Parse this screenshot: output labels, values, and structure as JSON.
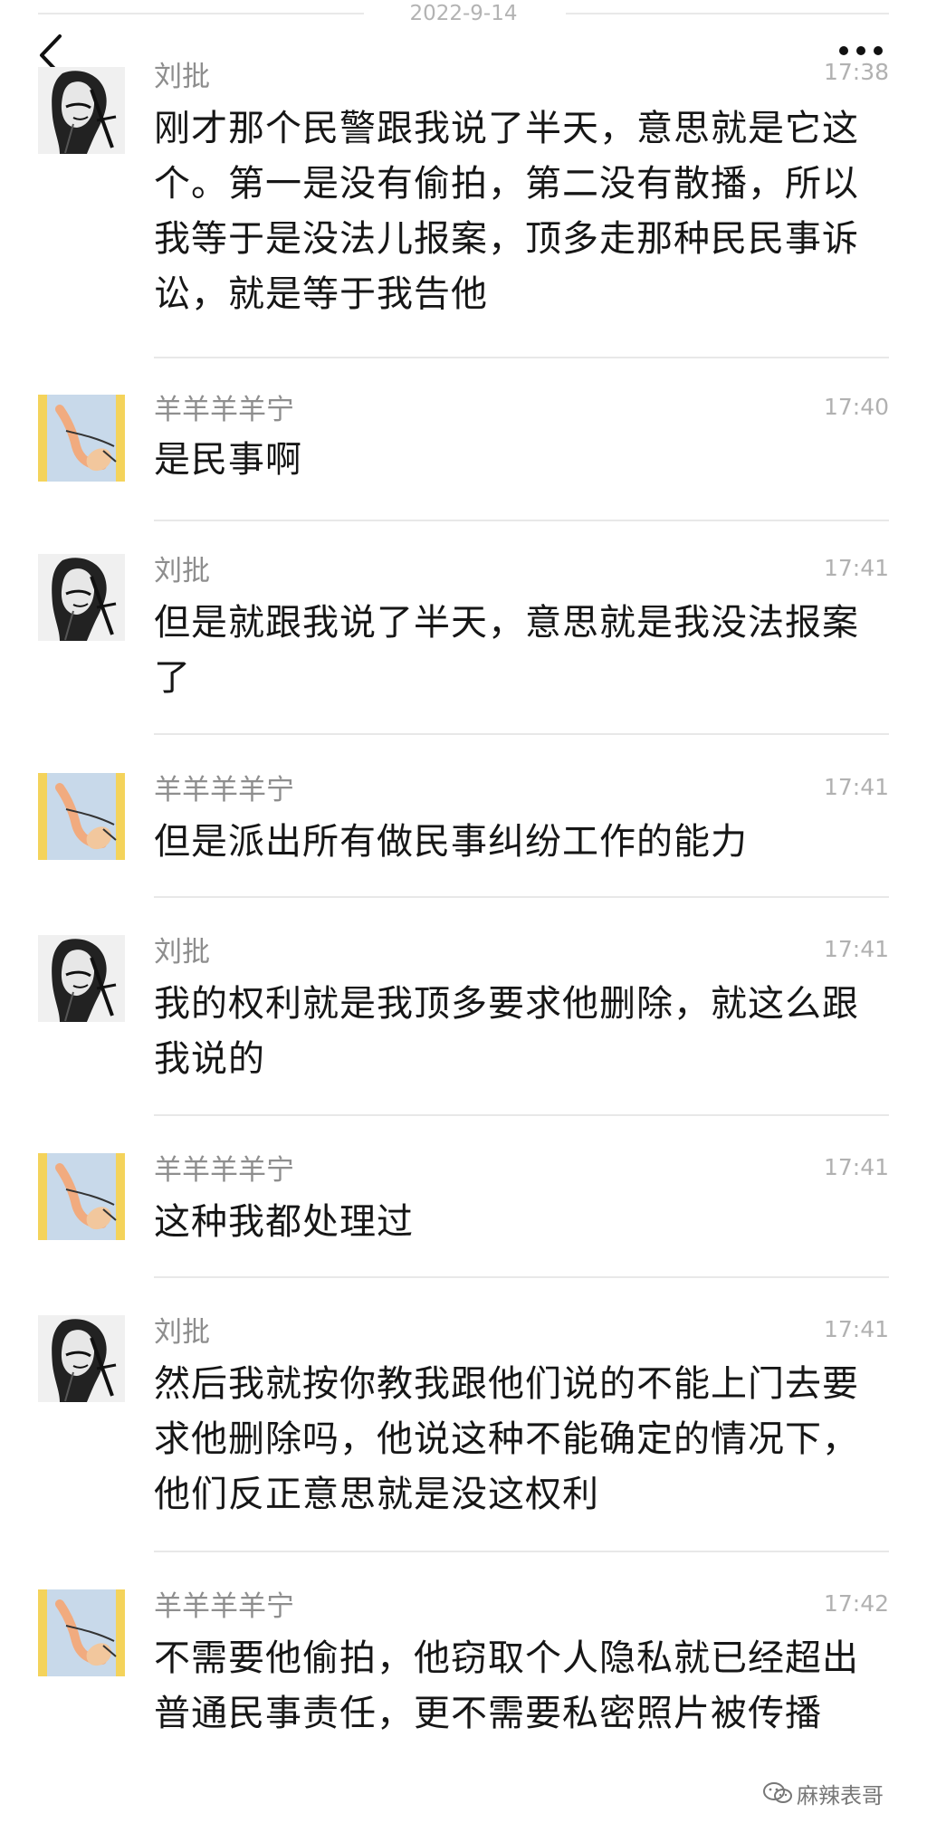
{
  "header": {
    "date": "2022-9-14",
    "back_icon": "chevron-left-icon",
    "more_icon": "more-horizontal-icon"
  },
  "messages": [
    {
      "sender": "刘批",
      "time": "17:38",
      "avatar": "liupi-avatar",
      "text": "刚才那个民警跟我说了半天，意思就是它这个。第一是没有偷拍，第二没有散播，所以我等于是没法儿报案，顶多走那种民民事诉讼，就是等于我告他"
    },
    {
      "sender": "羊羊羊羊宁",
      "time": "17:40",
      "avatar": "yangning-avatar",
      "text": "是民事啊"
    },
    {
      "sender": "刘批",
      "time": "17:41",
      "avatar": "liupi-avatar",
      "text": "但是就跟我说了半天，意思就是我没法报案了"
    },
    {
      "sender": "羊羊羊羊宁",
      "time": "17:41",
      "avatar": "yangning-avatar",
      "text": "但是派出所有做民事纠纷工作的能力"
    },
    {
      "sender": "刘批",
      "time": "17:41",
      "avatar": "liupi-avatar",
      "text": "我的权利就是我顶多要求他删除，就这么跟我说的"
    },
    {
      "sender": "羊羊羊羊宁",
      "time": "17:41",
      "avatar": "yangning-avatar",
      "text": "这种我都处理过"
    },
    {
      "sender": "刘批",
      "time": "17:41",
      "avatar": "liupi-avatar",
      "text": "然后我就按你教我跟他们说的不能上门去要求他删除吗，他说这种不能确定的情况下，他们反正意思就是没这权利"
    },
    {
      "sender": "羊羊羊羊宁",
      "time": "17:42",
      "avatar": "yangning-avatar",
      "text": "不需要他偷拍，他窃取个人隐私就已经超出普通民事责任，更不需要私密照片被传播"
    }
  ],
  "watermark": {
    "text": "麻辣表哥",
    "icon": "wechat-icon"
  },
  "colors": {
    "text": "#161616",
    "sender": "#8e8e8e",
    "time": "#b1b1b1",
    "separator": "#e8e8e8",
    "date": "#b3b3b3",
    "avatar_sky": "#c8d9ea",
    "avatar_frame": "#f4d35b"
  }
}
